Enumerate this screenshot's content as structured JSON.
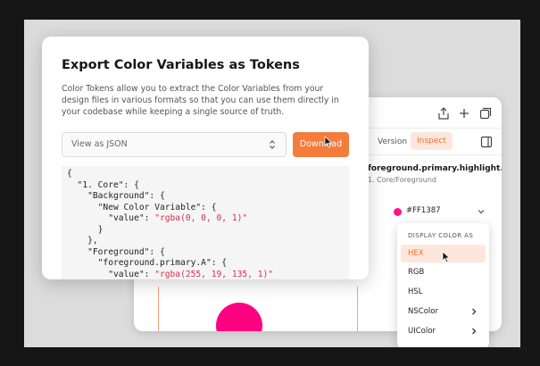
{
  "inspect_panel": {
    "icons": [
      "share-icon",
      "plus-icon",
      "copy-icon",
      "sidebar-icon"
    ],
    "tabs": {
      "version": "Version",
      "inspect": "Inspect"
    },
    "layer_name": "foreground.primary.highlight.A",
    "layer_path": "1. Core/Foreground",
    "color_value": "#FF1387",
    "swatch_color": "#FF1387"
  },
  "dropdown": {
    "header": "DISPLAY COLOR AS",
    "items": [
      {
        "label": "HEX",
        "active": true
      },
      {
        "label": "RGB"
      },
      {
        "label": "HSL"
      },
      {
        "label": "NSColor",
        "has_submenu": true
      },
      {
        "label": "UIColor",
        "has_submenu": true
      }
    ]
  },
  "export_modal": {
    "title": "Export Color Variables as Tokens",
    "description": "Color Tokens allow you to extract the Color Variables from your design files in various formats so that you can use them directly in your codebase while keeping a single source of truth.",
    "format_select": "View as JSON",
    "download_label": "Download",
    "code_lines": [
      "{",
      "  \"1. Core\": {",
      "    \"Background\": {",
      "      \"New Color Variable\": {",
      "        \"value\": \"rgba(0, 0, 0, 1)\"",
      "      }",
      "    },",
      "    \"Foreground\": {",
      "      \"foreground.primary.A\": {",
      "        \"value\": \"rgba(255, 19, 135, 1)\""
    ]
  },
  "colors": {
    "accent": "#F47C3C",
    "accent_soft": "#FDE7DC",
    "magenta": "#FF0080",
    "string": "#D62D53"
  }
}
